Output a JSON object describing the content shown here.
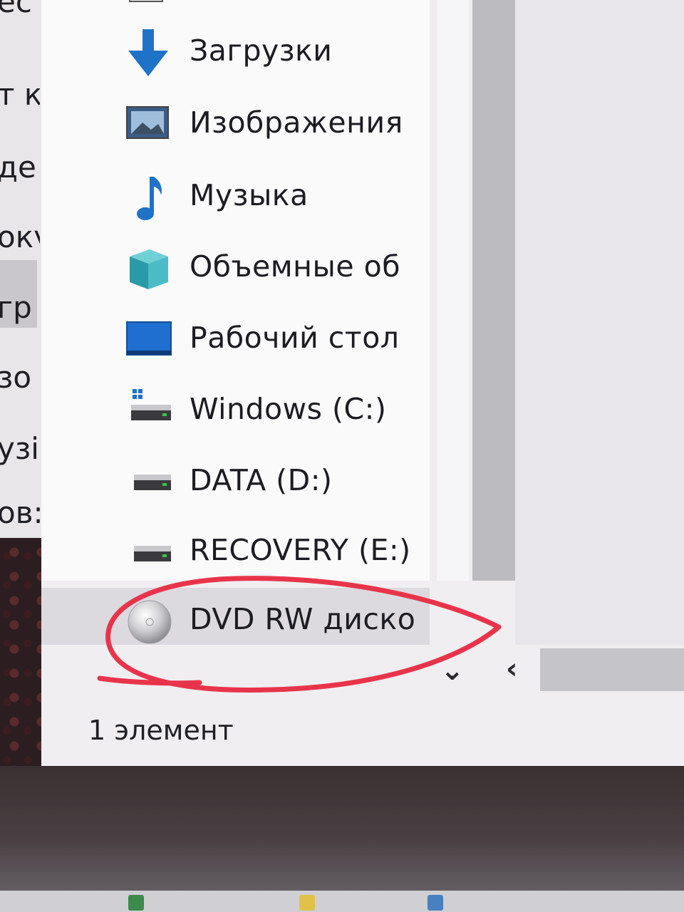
{
  "background_window": {
    "items": [
      "ес",
      "т к",
      "де",
      "окү",
      "гр",
      "зо",
      "узі",
      "ов:"
    ]
  },
  "navigation": {
    "items": [
      {
        "label": "Загрузки",
        "icon": "download-arrow-icon"
      },
      {
        "label": "Изображения",
        "icon": "pictures-folder-icon"
      },
      {
        "label": "Музыка",
        "icon": "music-note-icon"
      },
      {
        "label": "Объемные об",
        "icon": "3d-objects-icon"
      },
      {
        "label": "Рабочий стол",
        "icon": "desktop-folder-icon"
      },
      {
        "label": "Windows (C:)",
        "icon": "windows-drive-icon"
      },
      {
        "label": "DATA (D:)",
        "icon": "drive-icon"
      },
      {
        "label": "RECOVERY (E:)",
        "icon": "drive-icon"
      },
      {
        "label": "DVD RW диско",
        "icon": "dvd-disc-icon"
      }
    ]
  },
  "status_bar": {
    "item_count": "1 элемент"
  },
  "colors": {
    "annotation": "#e8344a",
    "selection": "#dcdadf",
    "text": "#1c1c22"
  }
}
